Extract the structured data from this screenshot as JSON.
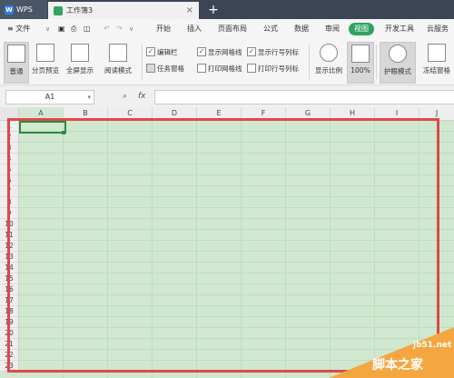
{
  "titlebar": {
    "app_tab": "WPS",
    "doc_tab": "工作簿3",
    "close_glyph": "×",
    "new_tab_glyph": "+"
  },
  "menu": {
    "file": "≡ 文件",
    "items": [
      "开始",
      "插入",
      "页面布局",
      "公式",
      "数据",
      "审阅",
      "视图",
      "开发工具",
      "云服务"
    ],
    "active": "视图"
  },
  "ribbon": {
    "normal": "普通",
    "page_preview": "分页预览",
    "fullscreen": "全屏显示",
    "reading_mode": "阅读模式",
    "checks": [
      {
        "label": "编辑栏",
        "checked": true
      },
      {
        "label": "任务窗格",
        "checked": false
      },
      {
        "label": "显示网格线",
        "checked": true
      },
      {
        "label": "打印网格线",
        "checked": false
      },
      {
        "label": "显示行号列标",
        "checked": true
      },
      {
        "label": "打印行号列标",
        "checked": false
      }
    ],
    "zoom_ratio": "显示比例",
    "zoom_100": "100%",
    "eye_protect": "护眼模式",
    "freeze": "冻结窗格"
  },
  "formula": {
    "name_box": "A1",
    "fx_label": "fx",
    "formula_value": ""
  },
  "sheet": {
    "columns": [
      "A",
      "B",
      "C",
      "D",
      "E",
      "F",
      "G",
      "H",
      "I",
      "J"
    ],
    "rows": [
      "1",
      "2",
      "3",
      "4",
      "5",
      "6",
      "7",
      "8",
      "9",
      "10",
      "11",
      "12",
      "13",
      "14",
      "15",
      "16",
      "17",
      "18",
      "19",
      "20",
      "21",
      "22",
      "23",
      "24",
      "25"
    ],
    "selected_cell": "A1",
    "grid_color": "#cfe8cf",
    "highlight_color": "#e04848"
  },
  "watermark": {
    "site": "jb51.net",
    "name": "脚本之家"
  }
}
